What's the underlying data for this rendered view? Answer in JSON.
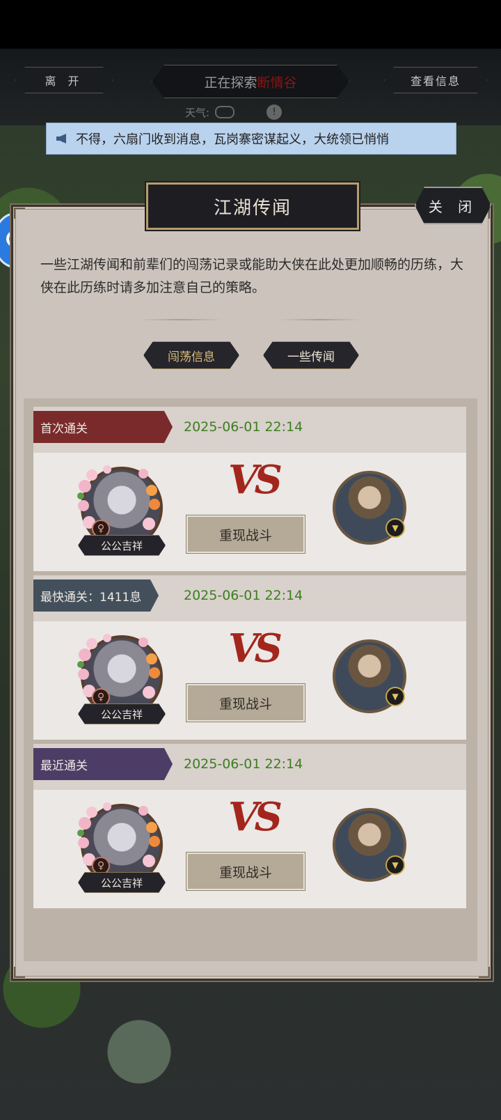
{
  "hud": {
    "leave_label": "离 开",
    "exploring_prefix": "正在探索",
    "location": "断情谷",
    "info_label": "查看信息",
    "weather_label": "天气:"
  },
  "ticker": {
    "text": "不得，六扇门收到消息，瓦岗寨密谋起义，大统领已悄悄"
  },
  "panel": {
    "title": "江湖传闻",
    "close_label": "关 闭",
    "description": "一些江湖传闻和前辈们的闯荡记录或能助大侠在此处更加顺畅的历练，大侠在此历练时请多加注意自己的策略。",
    "tabs": [
      {
        "label": "闯荡信息",
        "active": true
      },
      {
        "label": "一些传闻",
        "active": false
      }
    ]
  },
  "records": [
    {
      "type": "首次通关",
      "date": "2025-06-01 22:14",
      "hero_name": "公公吉祥",
      "vs": "VS",
      "replay_label": "重现战斗",
      "ribbon_color": "#7a2a2b"
    },
    {
      "type": "最快通关：1411息",
      "date": "2025-06-01 22:14",
      "hero_name": "公公吉祥",
      "vs": "VS",
      "replay_label": "重现战斗",
      "ribbon_color": "#43505c"
    },
    {
      "type": "最近通关",
      "date": "2025-06-01 22:14",
      "hero_name": "公公吉祥",
      "vs": "VS",
      "replay_label": "重现战斗",
      "ribbon_color": "#4d3d66"
    }
  ],
  "icons": {
    "speaker": "megaphone-icon",
    "female": "♀",
    "warning": "!"
  }
}
